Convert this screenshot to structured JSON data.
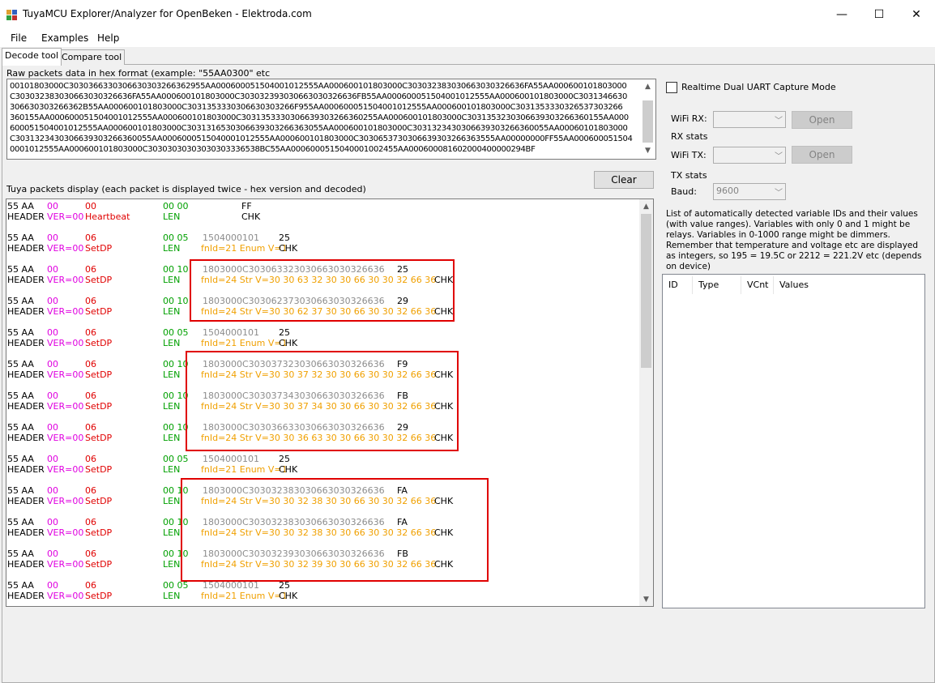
{
  "window": {
    "title": "TuyaMCU Explorer/Analyzer for OpenBeken - Elektroda.com",
    "minimize": "—",
    "maximize": "☐",
    "close": "✕"
  },
  "menu": [
    "File",
    "Examples",
    "Help"
  ],
  "tabs": [
    "Decode tool",
    "Compare tool"
  ],
  "raw": {
    "label": "Raw packets data in hex format (example: \"55AA0300\" etc",
    "lines": [
      "00101803000C303036633030663030326636​2955AA00060005150400101​2555AA00060010180300​0C30303238303066303032663​6FA55AA000600101803000",
      "C30303238303066303032663​6FA55AA00060010180300​0C3030323930306630303266​36FB55AA00060005150400​1012555AA00060010180300​0C3031346630",
      "306630303266362B55AA000​60010180300​0C303135333030663030326​6F955AA00060005150400​1012555AA00060010180300​0C303135333032653730326​6",
      "360155AA00060005150400​1012555AA00060010180300​0C303135333030663930326​6360255AA00060010180300​0C303135323030663930326​6360155AA000",
      "60005150400​1012555AA00060010180300​0C3031316530306639303266​363055AA00060010180300​0C303132343030663930326​6360055AA000601018030​00",
      "C303132343030663930326​6360055AA000600051504000​1012555AA00060010180300​0C3030653730306639303266​363555AA00000000FF55AA000600051504",
      "0001012555AA000600101803​000C303030303030303033​36538BC55AA00060005150400​01002455AA000600081602000400000294BF"
    ]
  },
  "packets_label": "Tuya packets display (each packet is displayed twice - hex version and decoded)",
  "clear_label": "Clear",
  "packets": [
    {
      "h55": "55 AA",
      "ver": "00",
      "cmd": "00",
      "len": "00 00",
      "data": "",
      "chk": "FF",
      "verd": "VER=00",
      "cmdd": "Heartbeat",
      "dec": "",
      "pos": "a"
    },
    {
      "h55": "55 AA",
      "ver": "00",
      "cmd": "06",
      "len": "00 05",
      "data": "1504000101",
      "chk": "25",
      "verd": "VER=00",
      "cmdd": "SetDP",
      "dec": "fnId=21 Enum V=1",
      "pos": "b"
    },
    {
      "h55": "55 AA",
      "ver": "00",
      "cmd": "06",
      "len": "00 10",
      "data": "1803000C303063323030663030326636",
      "chk": "25",
      "verd": "VER=00",
      "cmdd": "SetDP",
      "dec": "fnId=24 Str V=30 30 63 32 30 30 66 30 30 32 66 36",
      "pos": "c"
    },
    {
      "h55": "55 AA",
      "ver": "00",
      "cmd": "06",
      "len": "00 10",
      "data": "1803000C303062373030663030326636",
      "chk": "29",
      "verd": "VER=00",
      "cmdd": "SetDP",
      "dec": "fnId=24 Str V=30 30 62 37 30 30 66 30 30 32 66 36",
      "pos": "c"
    },
    {
      "h55": "55 AA",
      "ver": "00",
      "cmd": "06",
      "len": "00 05",
      "data": "1504000101",
      "chk": "25",
      "verd": "VER=00",
      "cmdd": "SetDP",
      "dec": "fnId=21 Enum V=1",
      "pos": "b"
    },
    {
      "h55": "55 AA",
      "ver": "00",
      "cmd": "06",
      "len": "00 10",
      "data": "1803000C303037323030663030326636",
      "chk": "F9",
      "verd": "VER=00",
      "cmdd": "SetDP",
      "dec": "fnId=24 Str V=30 30 37 32 30 30 66 30 30 32 66 36",
      "pos": "c"
    },
    {
      "h55": "55 AA",
      "ver": "00",
      "cmd": "06",
      "len": "00 10",
      "data": "1803000C303037343030663030326636",
      "chk": "FB",
      "verd": "VER=00",
      "cmdd": "SetDP",
      "dec": "fnId=24 Str V=30 30 37 34 30 30 66 30 30 32 66 36",
      "pos": "c"
    },
    {
      "h55": "55 AA",
      "ver": "00",
      "cmd": "06",
      "len": "00 10",
      "data": "1803000C303036633030663030326636",
      "chk": "29",
      "verd": "VER=00",
      "cmdd": "SetDP",
      "dec": "fnId=24 Str V=30 30 36 63 30 30 66 30 30 32 66 36",
      "pos": "c"
    },
    {
      "h55": "55 AA",
      "ver": "00",
      "cmd": "06",
      "len": "00 05",
      "data": "1504000101",
      "chk": "25",
      "verd": "VER=00",
      "cmdd": "SetDP",
      "dec": "fnId=21 Enum V=1",
      "pos": "b"
    },
    {
      "h55": "55 AA",
      "ver": "00",
      "cmd": "06",
      "len": "00 10",
      "data": "1803000C303032383030663030326636",
      "chk": "FA",
      "verd": "VER=00",
      "cmdd": "SetDP",
      "dec": "fnId=24 Str V=30 30 32 38 30 30 66 30 30 32 66 36",
      "pos": "c"
    },
    {
      "h55": "55 AA",
      "ver": "00",
      "cmd": "06",
      "len": "00 10",
      "data": "1803000C303032383030663030326636",
      "chk": "FA",
      "verd": "VER=00",
      "cmdd": "SetDP",
      "dec": "fnId=24 Str V=30 30 32 38 30 30 66 30 30 32 66 36",
      "pos": "c"
    },
    {
      "h55": "55 AA",
      "ver": "00",
      "cmd": "06",
      "len": "00 10",
      "data": "1803000C303032393030663030326636",
      "chk": "FB",
      "verd": "VER=00",
      "cmdd": "SetDP",
      "dec": "fnId=24 Str V=30 30 32 39 30 30 66 30 30 32 66 36",
      "pos": "c"
    },
    {
      "h55": "55 AA",
      "ver": "00",
      "cmd": "06",
      "len": "00 05",
      "data": "1504000101",
      "chk": "25",
      "verd": "VER=00",
      "cmdd": "SetDP",
      "dec": "fnId=21 Enum V=1",
      "pos": "b"
    }
  ],
  "decoded_fixed": {
    "header": "HEADER",
    "len": "LEN",
    "chk": "CHK"
  },
  "right": {
    "realtime_label": "Realtime Dual UART Capture Mode",
    "wifi_rx_label": "WiFi RX:",
    "rx_stats": "RX stats",
    "wifi_tx_label": "WiFi TX:",
    "tx_stats": "TX stats",
    "baud_label": "Baud:",
    "baud_value": "9600",
    "open_label": "Open",
    "info_lines": [
      "List of automatically detected variable IDs  and their values",
      "(with value ranges). Variables with only 0 and 1 might be",
      "relays. Variables in 0-1000 range might be dimmers.",
      "Remember that temperature and voltage etc are displayed",
      "as integers, so 195 = 19.5C or 2212 = 221.2V etc (depends",
      "on device)"
    ],
    "columns": [
      "ID",
      "Type",
      "VCnt",
      "Values"
    ]
  },
  "colors": {
    "magenta": "#e000e0",
    "red": "#e00000",
    "green": "#00a000",
    "gray": "#8c8c8c",
    "orange": "#f0a000"
  }
}
